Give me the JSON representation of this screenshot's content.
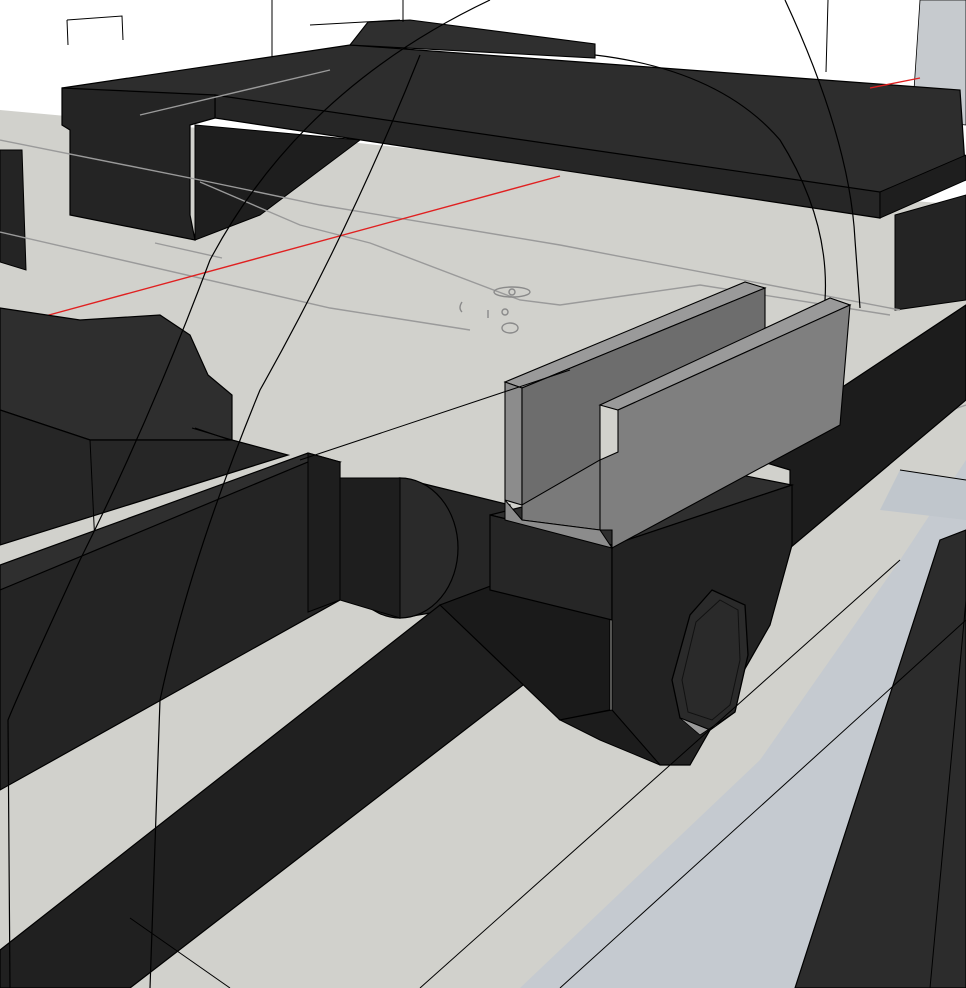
{
  "app": {
    "kind": "3d-modeling-viewport"
  },
  "viewport": {
    "colors": {
      "ground": "#d1d1cc",
      "floor_strip": "#c7ccd2",
      "solid_dark": "#242424",
      "solid_top": "#2d2d2d",
      "solid_side": "#1a1a1a",
      "bracket_face": "#7a7a7a",
      "bracket_light": "#8c8c8c",
      "edge": "#000000",
      "ghost_line": "#9a9a9a",
      "axis_red": "#e02020"
    },
    "icons": [
      "pivot-gizmo-icon"
    ]
  }
}
